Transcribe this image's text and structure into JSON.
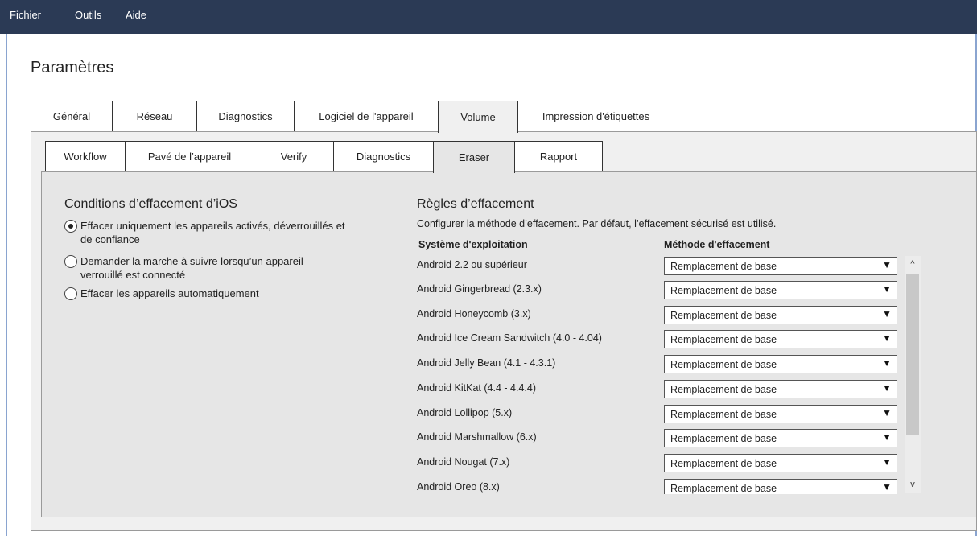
{
  "menu": {
    "file": "Fichier",
    "tools": "Outils",
    "help": "Aide"
  },
  "page": {
    "title": "Paramètres"
  },
  "main_tabs": [
    {
      "label": "Général"
    },
    {
      "label": "Réseau"
    },
    {
      "label": "Diagnostics"
    },
    {
      "label": "Logiciel de l'appareil"
    },
    {
      "label": "Volume",
      "active": true
    },
    {
      "label": "Impression d'étiquettes"
    }
  ],
  "sub_tabs": [
    {
      "label": "Workflow"
    },
    {
      "label": "Pavé de l’appareil"
    },
    {
      "label": "Verify"
    },
    {
      "label": "Diagnostics"
    },
    {
      "label": "Eraser",
      "active": true
    },
    {
      "label": "Rapport"
    }
  ],
  "ios": {
    "title": "Conditions d’effacement d’iOS",
    "options": [
      {
        "label": "Effacer uniquement les appareils activés, déverrouillés et de confiance",
        "checked": true
      },
      {
        "label": "Demander la marche à suivre lorsqu’un appareil verrouillé est connecté",
        "checked": false
      },
      {
        "label": "Effacer les appareils automatiquement",
        "checked": false
      }
    ]
  },
  "rules": {
    "title": "Règles d’effacement",
    "description": "Configurer la méthode d’effacement. Par défaut, l’effacement sécurisé est utilisé.",
    "col_os": "Système d'exploitation",
    "col_method": "Méthode d'effacement",
    "rows": [
      {
        "os": "Android 2.2 ou supérieur",
        "method": "Remplacement de base"
      },
      {
        "os": "Android Gingerbread (2.3.x)",
        "method": "Remplacement de base"
      },
      {
        "os": "Android Honeycomb (3.x)",
        "method": "Remplacement de base"
      },
      {
        "os": "Android Ice Cream Sandwitch (4.0 - 4.04)",
        "method": "Remplacement de base"
      },
      {
        "os": "Android Jelly Bean (4.1 - 4.3.1)",
        "method": "Remplacement de base"
      },
      {
        "os": "Android KitKat (4.4 - 4.4.4)",
        "method": "Remplacement de base"
      },
      {
        "os": "Android Lollipop (5.x)",
        "method": "Remplacement de base"
      },
      {
        "os": "Android Marshmallow (6.x)",
        "method": "Remplacement de base"
      },
      {
        "os": "Android Nougat (7.x)",
        "method": "Remplacement de base"
      },
      {
        "os": "Android Oreo (8.x)",
        "method": "Remplacement de base"
      }
    ]
  },
  "icons": {
    "dropdown": "▼",
    "scroll_up": "^",
    "scroll_down": "v"
  },
  "colors": {
    "menubar": "#2b3a55",
    "window_border": "#8aa4d0",
    "panel": "#f0f0f0"
  }
}
